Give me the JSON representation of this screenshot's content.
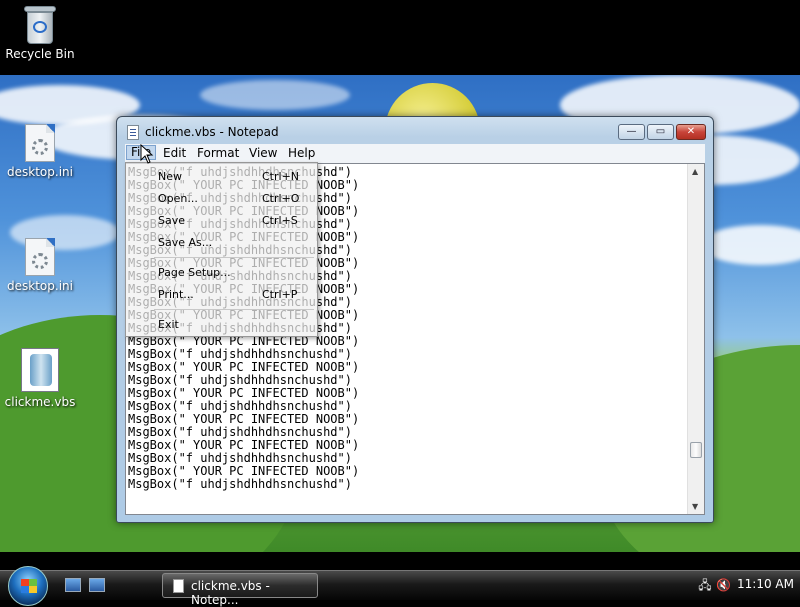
{
  "desktop": {
    "icons": [
      {
        "label": "Recycle Bin",
        "icon": "recycle-bin-icon"
      },
      {
        "label": "desktop.ini",
        "icon": "settings-file-icon"
      },
      {
        "label": "desktop.ini",
        "icon": "settings-file-icon"
      },
      {
        "label": "clickme.vbs",
        "icon": "vbs-script-icon"
      }
    ]
  },
  "window": {
    "title": "clickme.vbs - Notepad",
    "controls": {
      "minimize": "—",
      "maximize": "▭",
      "close": "✕"
    }
  },
  "menubar": {
    "items": [
      "File",
      "Edit",
      "Format",
      "View",
      "Help"
    ],
    "active": "File"
  },
  "file_menu": {
    "items": [
      {
        "label": "New",
        "shortcut": "Ctrl+N"
      },
      {
        "label": "Open...",
        "shortcut": "Ctrl+O"
      },
      {
        "label": "Save",
        "shortcut": "Ctrl+S"
      },
      {
        "label": "Save As...",
        "shortcut": ""
      },
      {
        "label": "Page Setup...",
        "shortcut": ""
      },
      {
        "label": "Print...",
        "shortcut": "Ctrl+P"
      },
      {
        "label": "Exit",
        "shortcut": ""
      }
    ]
  },
  "editor": {
    "lines": [
      "MsgBox(\"f uhdjshdhhdhsnchushd\")",
      "MsgBox(\" YOUR PC INFECTED NOOB\")",
      "MsgBox(\"f uhdjshdhhdhsnchushd\")",
      "MsgBox(\" YOUR PC INFECTED NOOB\")",
      "MsgBox(\"f uhdjshdhhdhsnchushd\")",
      "MsgBox(\" YOUR PC INFECTED NOOB\")",
      "MsgBox(\"f uhdjshdhhdhsnchushd\")",
      "MsgBox(\" YOUR PC INFECTED NOOB\")",
      "MsgBox(\"f uhdjshdhhdhsnchushd\")",
      "MsgBox(\" YOUR PC INFECTED NOOB\")",
      "MsgBox(\"f uhdjshdhhdhsnchushd\")",
      "MsgBox(\" YOUR PC INFECTED NOOB\")",
      "MsgBox(\"f uhdjshdhhdhsnchushd\")",
      "MsgBox(\" YOUR PC INFECTED NOOB\")",
      "MsgBox(\"f uhdjshdhhdhsnchushd\")",
      "MsgBox(\" YOUR PC INFECTED NOOB\")",
      "MsgBox(\"f uhdjshdhhdhsnchushd\")",
      "MsgBox(\" YOUR PC INFECTED NOOB\")",
      "MsgBox(\"f uhdjshdhhdhsnchushd\")",
      "MsgBox(\" YOUR PC INFECTED NOOB\")",
      "MsgBox(\"f uhdjshdhhdhsnchushd\")",
      "MsgBox(\" YOUR PC INFECTED NOOB\")",
      "MsgBox(\"f uhdjshdhhdhsnchushd\")",
      "MsgBox(\" YOUR PC INFECTED NOOB\")",
      "MsgBox(\"f uhdjshdhhdhsnchushd\")"
    ]
  },
  "taskbar": {
    "task_label": "clickme.vbs - Notep...",
    "clock": "11:10 AM",
    "tray_icons": [
      "network-icon",
      "volume-muted-icon"
    ]
  }
}
